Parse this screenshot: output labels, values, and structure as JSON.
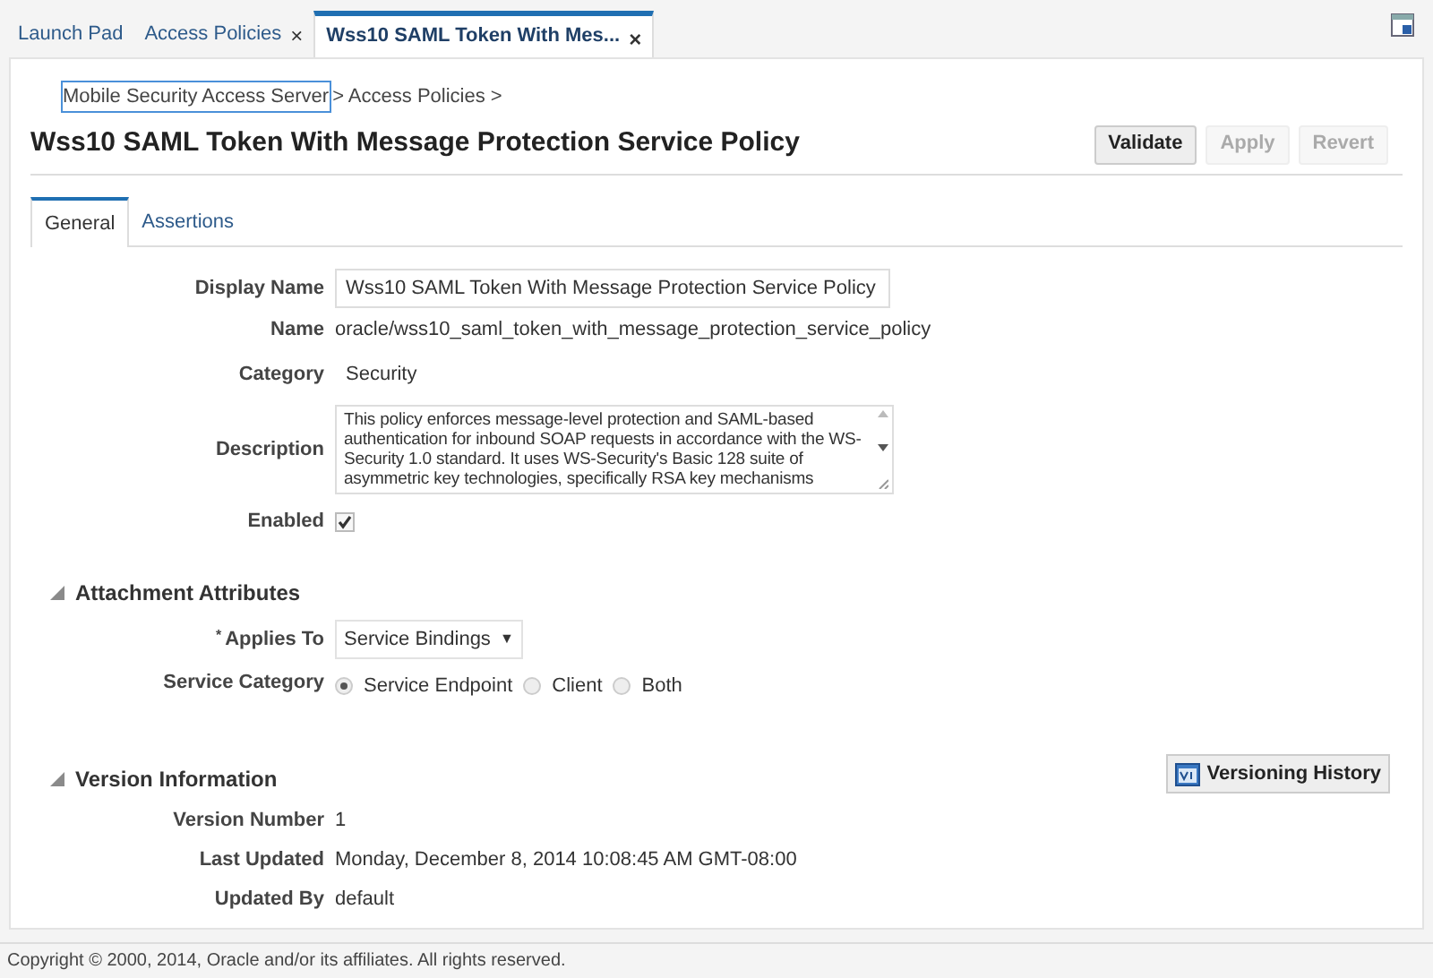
{
  "tabs": [
    {
      "label": "Launch Pad",
      "selected": false
    },
    {
      "label": "Access Policies",
      "selected": false,
      "close": "×"
    },
    {
      "label": "Wss10 SAML Token With Mes...",
      "selected": true,
      "close": "×"
    }
  ],
  "breadcrumb": [
    {
      "label": "Mobile Security Access Server",
      "focused": true
    },
    {
      "label": "> Access Policies >",
      "focused": false
    }
  ],
  "title": "Wss10 SAML Token With Message Protection Service Policy",
  "actions": [
    {
      "label": "Validate",
      "disabled": false
    },
    {
      "label": "Apply",
      "disabled": true
    },
    {
      "label": "Revert",
      "disabled": true
    }
  ],
  "subtabs": [
    {
      "label": "General",
      "selected": true
    },
    {
      "label": "Assertions",
      "selected": false
    }
  ],
  "general": [
    {
      "kind": "input",
      "label": "Display Name",
      "value": "Wss10 SAML Token With Message Protection Service Policy"
    },
    {
      "kind": "text",
      "label": "Name",
      "value": "oracle/wss10_saml_token_with_message_protection_service_policy"
    },
    {
      "kind": "text",
      "label": "Category",
      "value": "Security"
    },
    {
      "kind": "textarea",
      "label": "Description",
      "value": "This policy enforces message-level protection and SAML-based authentication for inbound SOAP requests in accordance with the WS-Security 1.0 standard. It uses WS-Security's Basic 128 suite of asymmetric key technologies, specifically RSA key mechanisms"
    },
    {
      "kind": "checkbox",
      "label": "Enabled",
      "checked": true
    }
  ],
  "attachment": {
    "title": "Attachment Attributes",
    "expanded": true,
    "applies_to": {
      "label": "Applies To",
      "required_mark": "*",
      "value": "Service Bindings",
      "caret": "▼"
    },
    "service_category": {
      "label": "Service Category",
      "options": [
        {
          "label": "Service Endpoint",
          "selected": true
        },
        {
          "label": "Client",
          "selected": false
        },
        {
          "label": "Both",
          "selected": false
        }
      ]
    }
  },
  "version": {
    "title": "Version Information",
    "expanded": true,
    "button": "Versioning History",
    "rows": [
      {
        "label": "Version Number",
        "value": "1"
      },
      {
        "label": "Last Updated",
        "value": "Monday, December 8, 2014 10:08:45 AM GMT-08:00"
      },
      {
        "label": "Updated By",
        "value": "default"
      }
    ]
  },
  "footer": "Copyright © 2000, 2014, Oracle and/or its affiliates. All rights reserved."
}
